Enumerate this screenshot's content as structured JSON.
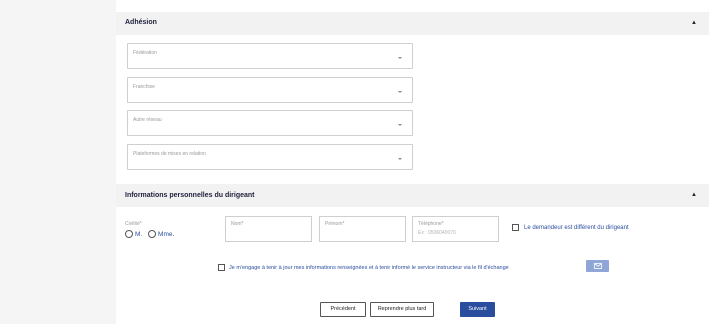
{
  "adhesion": {
    "title": "Adhésion",
    "fields": [
      {
        "label": "Fédération"
      },
      {
        "label": "Franchise"
      },
      {
        "label": "Autre réseau"
      },
      {
        "label": "Plateformes de mises en relation"
      }
    ]
  },
  "perso": {
    "title": "Informations personnelles du dirigeant",
    "civilite_label": "Civilité*",
    "civilite_options": [
      "M.",
      "Mme."
    ],
    "nom_label": "Nom*",
    "prenom_label": "Prénom*",
    "telephone_label": "Téléphone*",
    "telephone_placeholder": "Ex : 0506040070",
    "different_dirigeant_label": "Le demandeur est différent du dirigeant"
  },
  "engagement": {
    "label": "Je m'engage à tenir à jour mes informations renseignées et à tenir informé le service instructeur via le fil d'échange"
  },
  "actions": {
    "previous": "Précédent",
    "later": "Reprendre plus tard",
    "next": "Suivant"
  },
  "colors": {
    "primary": "#2b4d9e",
    "mail_button": "#8fa6d6",
    "section_bg": "#f2f2f2"
  }
}
